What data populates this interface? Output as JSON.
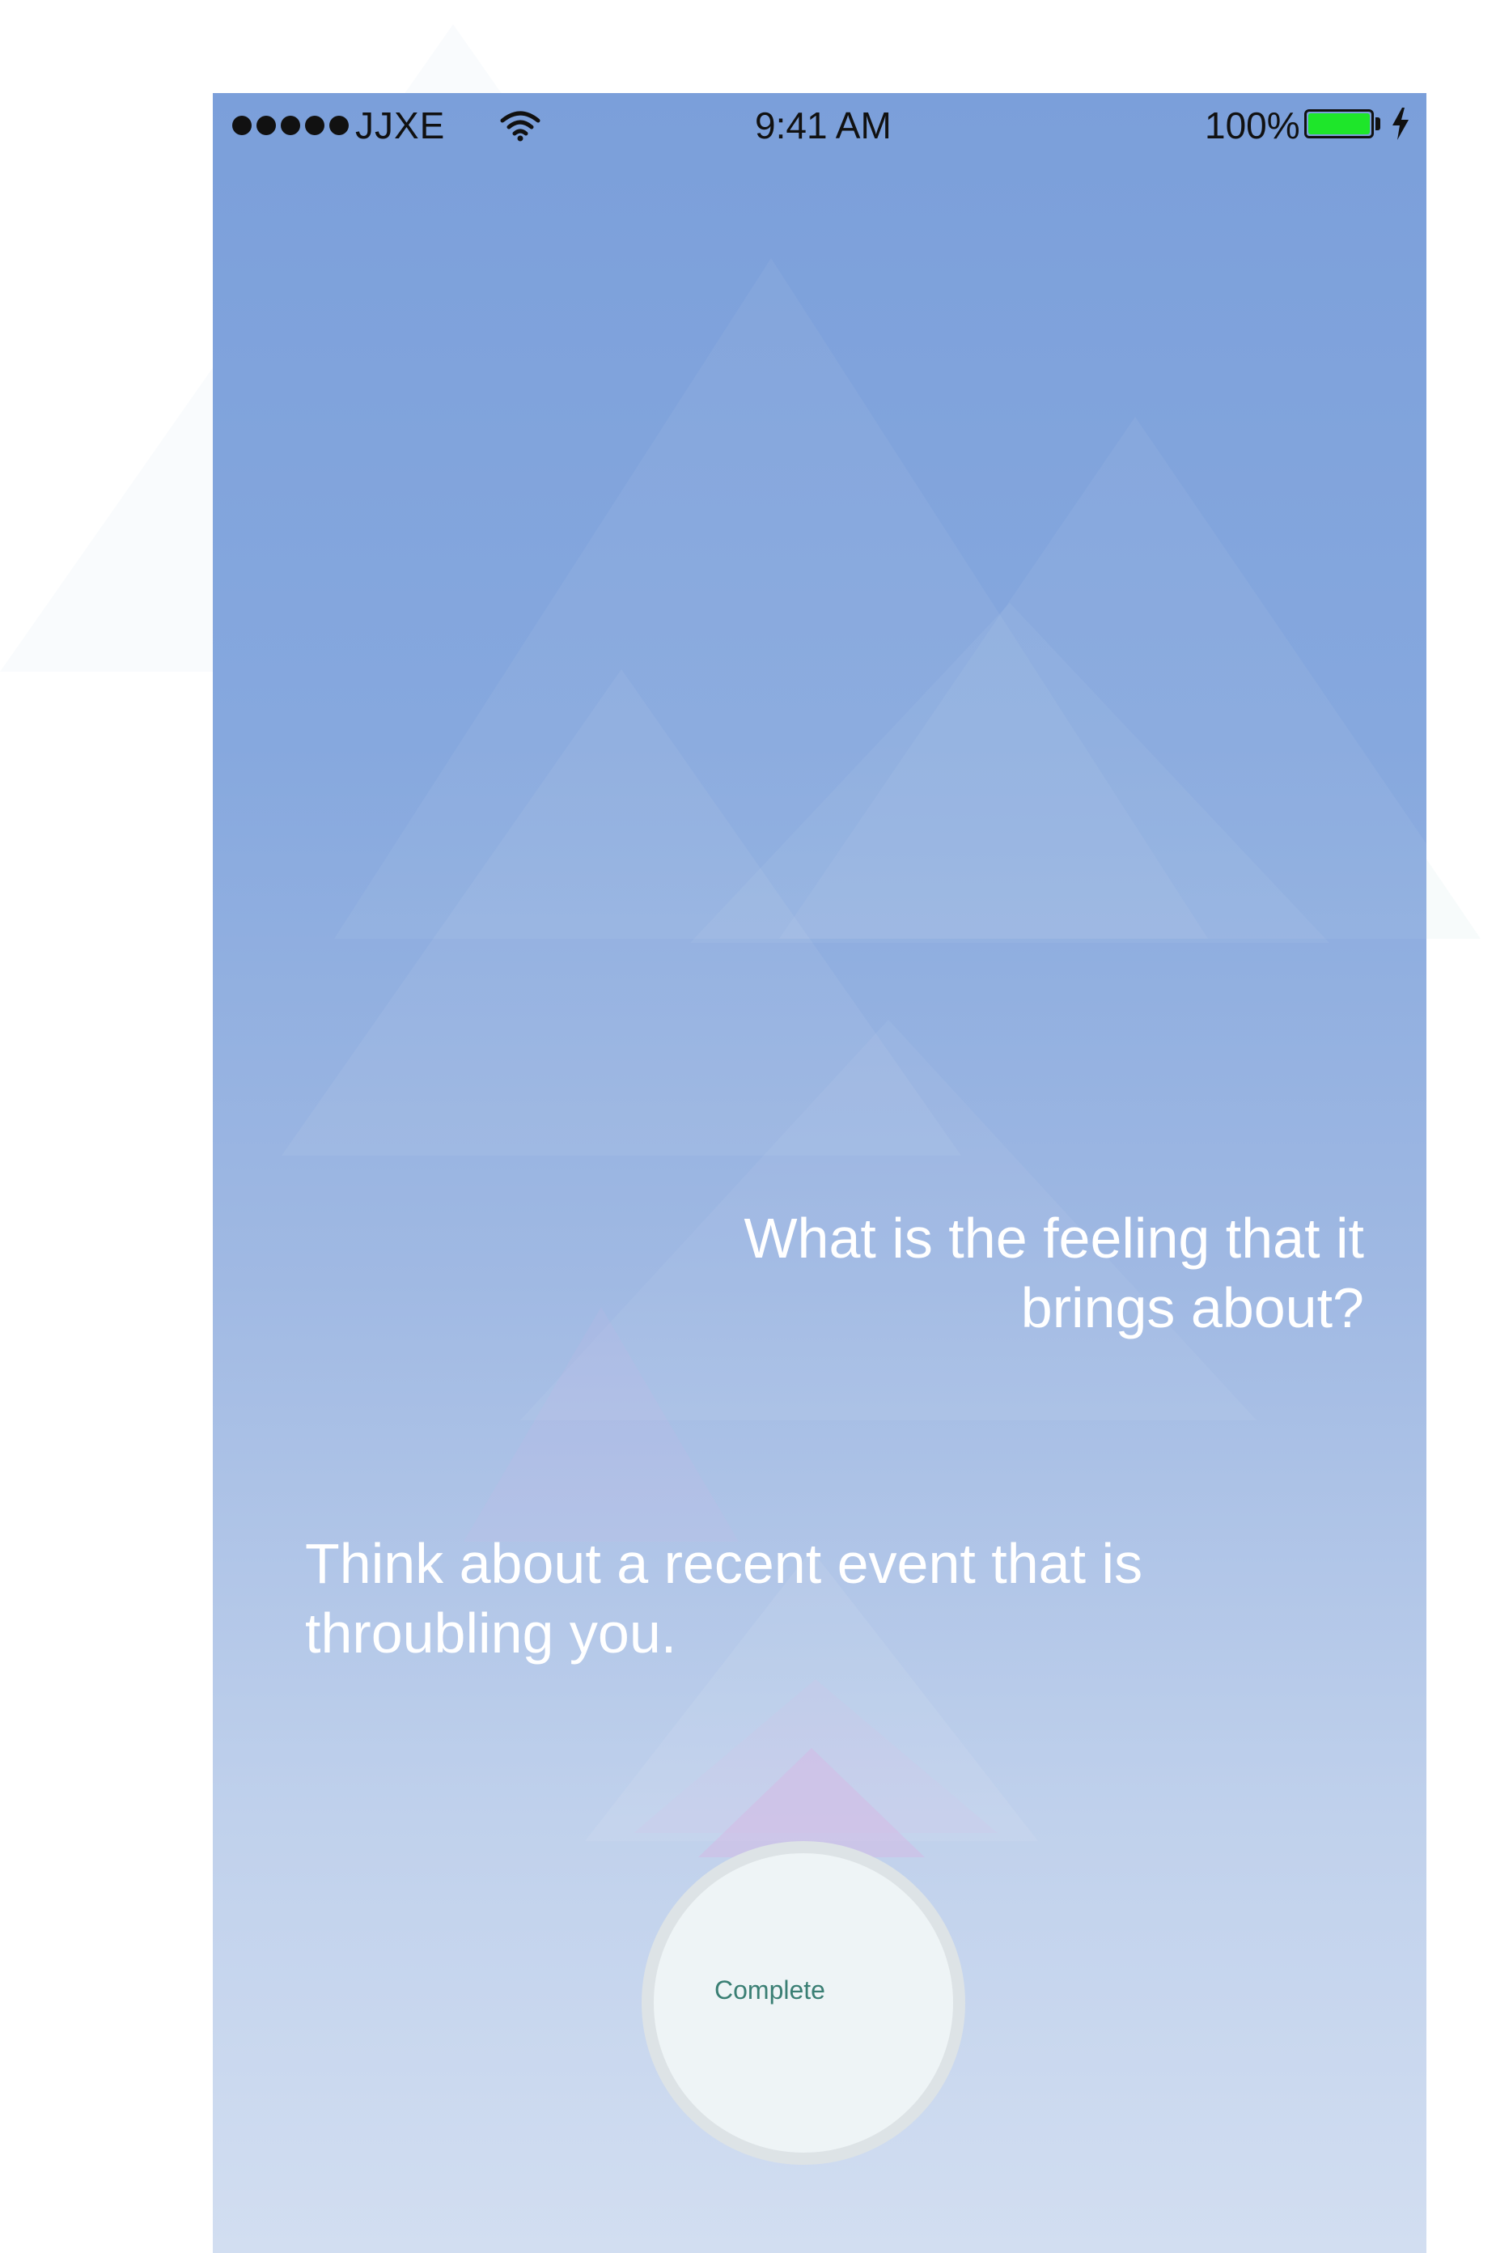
{
  "status_bar": {
    "carrier": "JJXE",
    "time": "9:41 AM",
    "battery_percent": "100%",
    "signal_bars": 5,
    "wifi_icon": "wifi-icon",
    "battery_icon": "battery-icon",
    "charging_icon": "charging-bolt-icon",
    "battery_color": "#1ee62a"
  },
  "content": {
    "question": "What is the feeling that it brings about?",
    "prompt": "Think about a recent event that is throubling you."
  },
  "actions": {
    "complete_label": "Complete"
  },
  "colors": {
    "gradient_top": "#7b9fda",
    "gradient_bottom": "#d2def1",
    "button_fill": "#eef4f6",
    "button_ring": "#dde3e6",
    "button_text": "#3a7f74"
  }
}
